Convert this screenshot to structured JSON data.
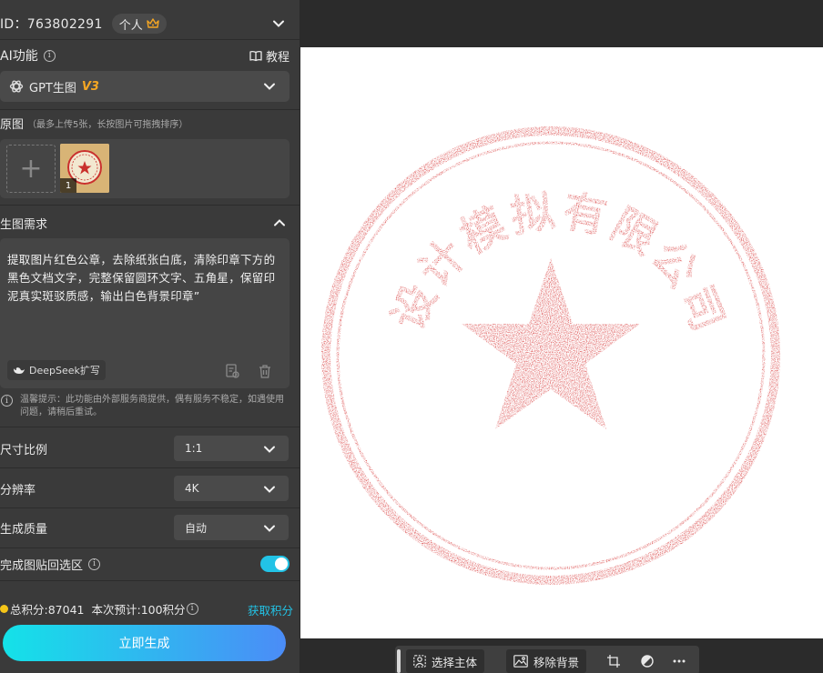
{
  "account": {
    "id_text": "ID：763802291",
    "badge_label": "个人"
  },
  "ai": {
    "title": "AI功能",
    "tutorial_label": "教程",
    "model_label": "GPT生图",
    "model_version": "V3"
  },
  "source": {
    "title": "原图",
    "hint": "（最多上传5张，长按图片可拖拽排序）",
    "thumb_index": "1"
  },
  "requirement": {
    "title": "生图需求",
    "prompt": "提取图片红色公章，去除纸张白底，清除印章下方的黑色文档文字，完整保留圆环文字、五角星，保留印泥真实斑驳质感，输出白色背景印章”",
    "deepseek_label": "DeepSeek扩写"
  },
  "tip_text": "温馨提示：此功能由外部服务商提供，偶有服务不稳定，如遇使用问题，请稍后重试。",
  "options": {
    "ratio_label": "尺寸比例",
    "ratio_value": "1:1",
    "resolution_label": "分辨率",
    "resolution_value": "4K",
    "quality_label": "生成质量",
    "quality_value": "自动",
    "paste_back_label": "完成图贴回选区",
    "paste_back_on": true
  },
  "points": {
    "total_text": "总积分:87041",
    "estimate_text": "本次预计:100积分",
    "get_label": "获取积分"
  },
  "generate_label": "立即生成",
  "stamp": {
    "ring_text": "设计模拟有限公司",
    "color": "#d42a2a"
  },
  "toolbar": {
    "select_subject_label": "选择主体",
    "remove_bg_label": "移除背景"
  },
  "colors": {
    "accent": "#22c3e6",
    "version": "#f5a623"
  }
}
